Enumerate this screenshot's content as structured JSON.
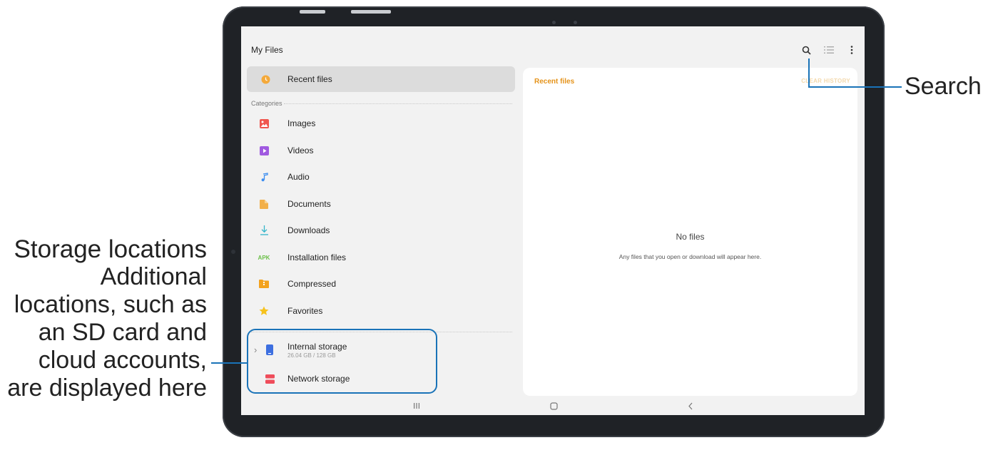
{
  "app": {
    "title": "My Files"
  },
  "sidebar": {
    "recent": {
      "label": "Recent files",
      "icon": "clock-icon",
      "color": "#f4a93a"
    },
    "categories_label": "Categories",
    "categories": [
      {
        "label": "Images",
        "icon": "image-icon",
        "color": "#f0564e"
      },
      {
        "label": "Videos",
        "icon": "video-icon",
        "color": "#a05ae0"
      },
      {
        "label": "Audio",
        "icon": "music-note-icon",
        "color": "#3d8ef0"
      },
      {
        "label": "Documents",
        "icon": "document-icon",
        "color": "#f2b04a"
      },
      {
        "label": "Downloads",
        "icon": "download-icon",
        "color": "#33b5c9"
      },
      {
        "label": "Installation files",
        "icon": "apk-icon",
        "color": "#6dc04a"
      },
      {
        "label": "Compressed",
        "icon": "folder-zip-icon",
        "color": "#f3a21e"
      },
      {
        "label": "Favorites",
        "icon": "star-icon",
        "color": "#f6c21c"
      }
    ],
    "storage": [
      {
        "label": "Internal storage",
        "sub": "26.04 GB / 128 GB",
        "icon": "phone-storage-icon",
        "color": "#3d6fe0"
      },
      {
        "label": "Network storage",
        "icon": "server-icon",
        "color": "#ef4d5b"
      }
    ]
  },
  "panel": {
    "title": "Recent files",
    "action": "CLEAR HISTORY",
    "empty_title": "No files",
    "empty_desc": "Any files that you open or download will appear here."
  },
  "callouts": {
    "search": "Search",
    "storage_title": "Storage locations",
    "storage_desc": "Additional locations, such as an SD card and cloud accounts, are displayed here"
  },
  "colors": {
    "accent": "#e5931a",
    "callout": "#1a73b8"
  }
}
